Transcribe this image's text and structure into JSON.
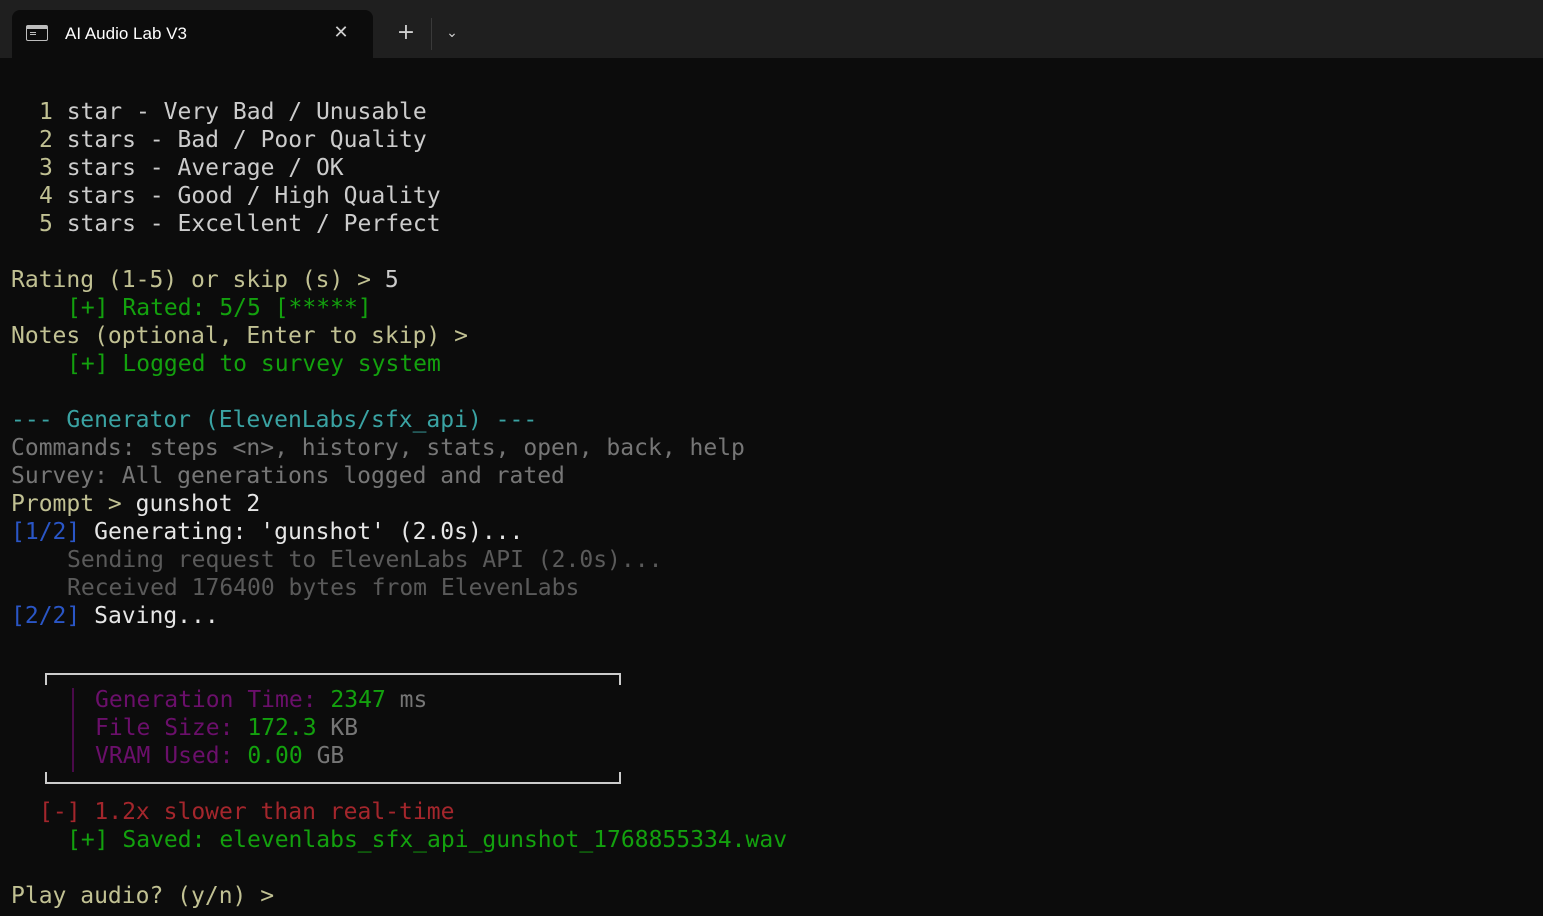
{
  "window": {
    "tab_title": "AI Audio Lab V3",
    "icons": {
      "tab": "terminal-icon",
      "close": "close-icon",
      "new_tab": "plus-icon",
      "dropdown": "chevron-down-icon"
    },
    "close_glyph": "✕",
    "new_tab_glyph": "+",
    "dropdown_glyph": "⌄"
  },
  "rating_scale": [
    {
      "num": "1",
      "text": " star - Very Bad / Unusable"
    },
    {
      "num": "2",
      "text": " stars - Bad / Poor Quality"
    },
    {
      "num": "3",
      "text": " stars - Average / OK"
    },
    {
      "num": "4",
      "text": " stars - Good / High Quality"
    },
    {
      "num": "5",
      "text": " stars - Excellent / Perfect"
    }
  ],
  "rating_prompt": {
    "label": "Rating (1-5) or skip (s) > ",
    "value": "5"
  },
  "rated_msg": "[+] Rated: 5/5 [*****]",
  "notes_prompt": "Notes (optional, Enter to skip) >",
  "logged_msg": "[+] Logged to survey system",
  "generator_header": "--- Generator (ElevenLabs/sfx_api) ---",
  "commands_line": "Commands: steps <n>, history, stats, open, back, help",
  "survey_line": "Survey: All generations logged and rated",
  "prompt": {
    "label": "Prompt > ",
    "value": "gunshot 2"
  },
  "step1": {
    "tag": "[1/2]",
    "text": " Generating: 'gunshot' (2.0s)..."
  },
  "sending_line": "Sending request to ElevenLabs API (2.0s)...",
  "received_line": "Received 176400 bytes from ElevenLabs",
  "step2": {
    "tag": "[2/2]",
    "text": " Saving..."
  },
  "stats": {
    "generation_time": {
      "label": "Generation Time: ",
      "value": "2347",
      "unit": " ms"
    },
    "file_size": {
      "label": "File Size: ",
      "value": "172.3",
      "unit": " KB"
    },
    "vram_used": {
      "label": "VRAM Used: ",
      "value": "0.00",
      "unit": " GB"
    }
  },
  "speed_msg": {
    "tag": "[-]",
    "text": " 1.2x slower than real-time"
  },
  "saved_msg": "[+] Saved: elevenlabs_sfx_api_gunshot_1768855334.wav",
  "play_prompt": "Play audio? (y/n) >",
  "colors": {
    "background": "#0c0c0c",
    "success": "#13a10e",
    "prompt": "#c1c193",
    "header": "#3aa3a3",
    "muted": "#767676",
    "step_tag": "#2a56c6",
    "stat_label": "#6b0f6b",
    "warning": "#a4262c"
  }
}
